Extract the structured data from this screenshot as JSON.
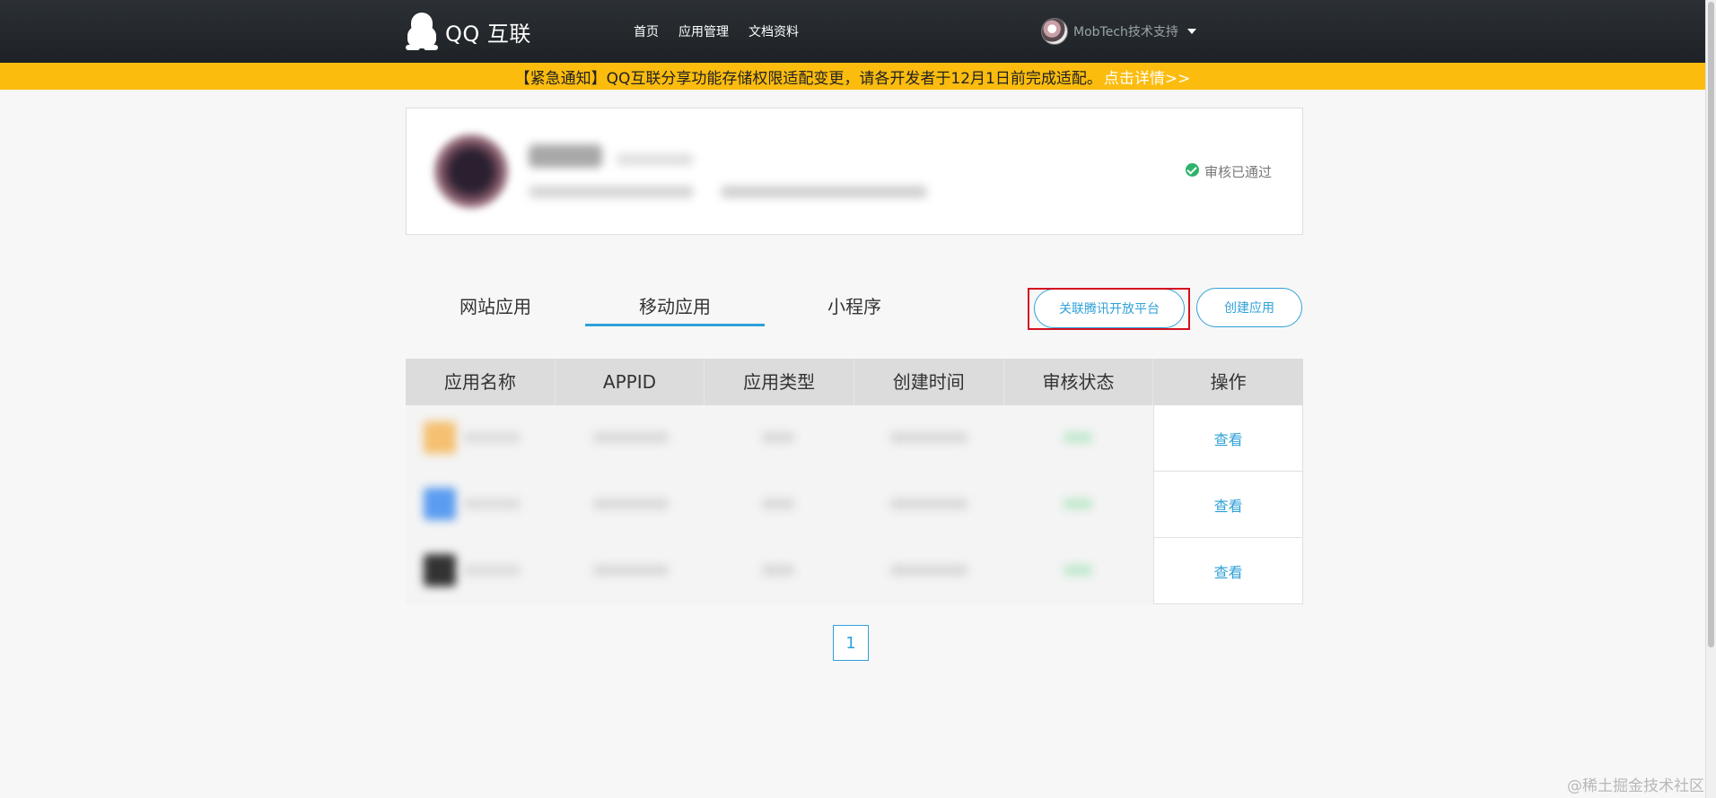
{
  "header": {
    "logo_text": "QQ 互联",
    "nav": [
      "首页",
      "应用管理",
      "文档资料"
    ],
    "username": "MobTech技术支持"
  },
  "notice": {
    "text": "【紧急通知】QQ互联分享功能存储权限适配变更，请各开发者于12月1日前完成适配。",
    "link": "点击详情>>"
  },
  "profile": {
    "status": "审核已通过",
    "status_color": "#2db36b"
  },
  "tabs": [
    "网站应用",
    "移动应用",
    "小程序"
  ],
  "active_tab": "移动应用",
  "buttons": {
    "link_platform": "关联腾讯开放平台",
    "create_app": "创建应用"
  },
  "table": {
    "columns": [
      "应用名称",
      "APPID",
      "应用类型",
      "创建时间",
      "审核状态",
      "操作"
    ],
    "rows": [
      {
        "action": "查看"
      },
      {
        "action": "查看"
      },
      {
        "action": "查看"
      }
    ]
  },
  "pagination": {
    "current": "1"
  },
  "watermark": "@稀土掘金技术社区",
  "colors": {
    "accent": "#30a1d8",
    "notice_bg": "#fbbc0e",
    "highlight": "#d4101e"
  }
}
